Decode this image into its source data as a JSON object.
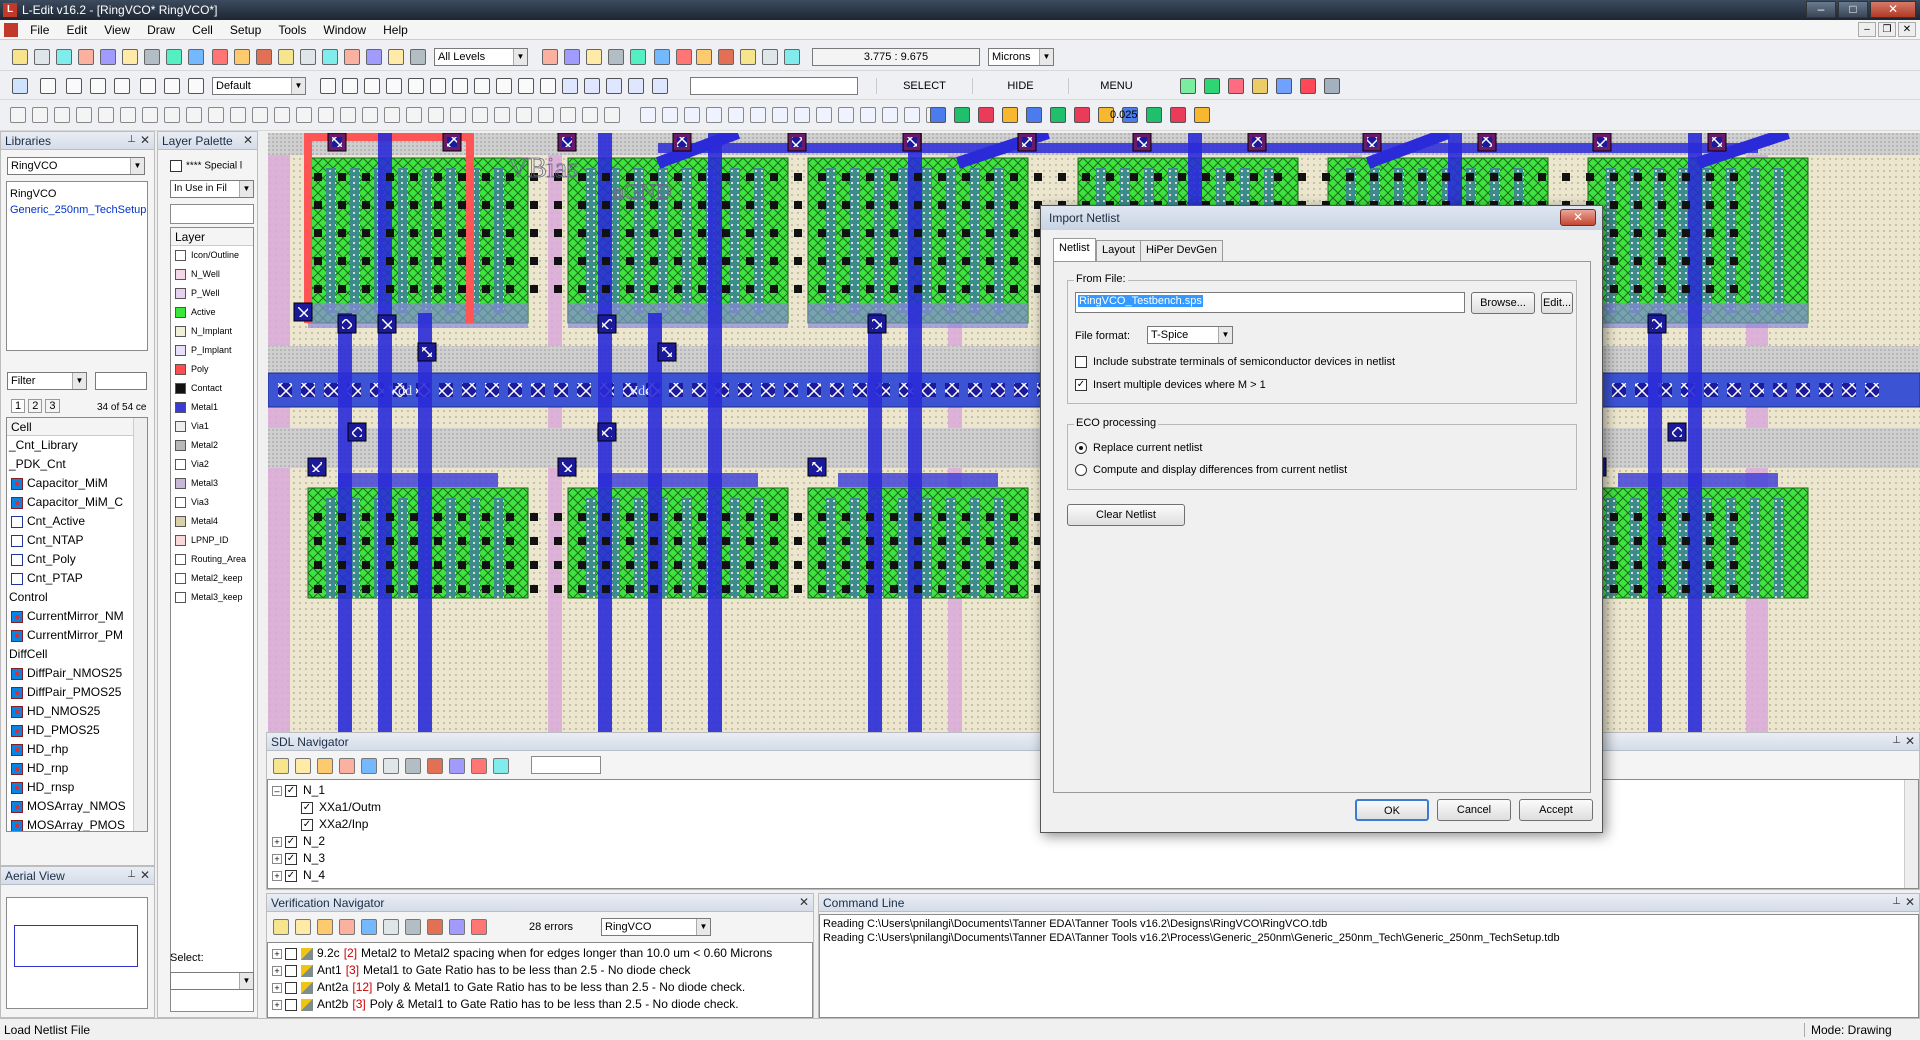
{
  "window": {
    "title": "L-Edit v16.2 - [RingVCO*    RingVCO*]",
    "btn_min": "–",
    "btn_max": "□",
    "btn_close": "✕"
  },
  "menu": [
    "File",
    "Edit",
    "View",
    "Draw",
    "Cell",
    "Setup",
    "Tools",
    "Window",
    "Help"
  ],
  "toolbar": {
    "level_select": "All Levels",
    "coords": "3.775 : 9.675",
    "units_select": "Microns",
    "style_select": "Default",
    "select_btn": "SELECT",
    "hide_btn": "HIDE",
    "menu_btn": "MENU",
    "snap_value": "0.025"
  },
  "libraries": {
    "title": "Libraries",
    "lib_select": "RingVCO",
    "items": [
      "RingVCO",
      "Generic_250nm_TechSetup"
    ],
    "filter_select": "Filter",
    "page_tabs": [
      "1",
      "2",
      "3"
    ],
    "count": "34 of 54 ce",
    "cell_header": "Cell",
    "cells": [
      {
        "name": "_Cnt_Library",
        "type": "group"
      },
      {
        "name": "_PDK_Cnt",
        "type": "group"
      },
      {
        "name": "Capacitor_MiM",
        "type": "gen"
      },
      {
        "name": "Capacitor_MiM_C",
        "type": "gen"
      },
      {
        "name": "Cnt_Active",
        "type": "cell"
      },
      {
        "name": "Cnt_NTAP",
        "type": "cell"
      },
      {
        "name": "Cnt_Poly",
        "type": "cell"
      },
      {
        "name": "Cnt_PTAP",
        "type": "cell"
      },
      {
        "name": "Control",
        "type": "group"
      },
      {
        "name": "CurrentMirror_NM",
        "type": "gen"
      },
      {
        "name": "CurrentMirror_PM",
        "type": "gen"
      },
      {
        "name": "DiffCell",
        "type": "group"
      },
      {
        "name": "DiffPair_NMOS25",
        "type": "gen"
      },
      {
        "name": "DiffPair_PMOS25",
        "type": "gen"
      },
      {
        "name": "HD_NMOS25",
        "type": "gen"
      },
      {
        "name": "HD_PMOS25",
        "type": "gen"
      },
      {
        "name": "HD_rhp",
        "type": "gen"
      },
      {
        "name": "HD_rnp",
        "type": "gen"
      },
      {
        "name": "HD_rnsp",
        "type": "gen"
      },
      {
        "name": "MOSArray_NMOS",
        "type": "gen"
      },
      {
        "name": "MOSArray_PMOS",
        "type": "gen"
      }
    ]
  },
  "aerial": {
    "title": "Aerial View"
  },
  "layer_palette": {
    "title": "Layer Palette",
    "special": "**** Special l",
    "filter_select": "In Use in Fil",
    "layer_header": "Layer",
    "select_label": "Select:",
    "layers": [
      {
        "name": "Icon/Outline",
        "color": "#ffffff"
      },
      {
        "name": "N_Well",
        "color": "#f4d8e8"
      },
      {
        "name": "P_Well",
        "color": "#e8d0f0"
      },
      {
        "name": "Active",
        "color": "#39e639"
      },
      {
        "name": "N_Implant",
        "color": "#f0f0d8"
      },
      {
        "name": "P_Implant",
        "color": "#e8e0f8"
      },
      {
        "name": "Poly",
        "color": "#ff4d4d"
      },
      {
        "name": "Contact",
        "color": "#111111"
      },
      {
        "name": "Metal1",
        "color": "#3a3ad8"
      },
      {
        "name": "Via1",
        "color": "#eeeeee"
      },
      {
        "name": "Metal2",
        "color": "#b8b8b8"
      },
      {
        "name": "Via2",
        "color": "#ffffff"
      },
      {
        "name": "Metal3",
        "color": "#c8b8d8"
      },
      {
        "name": "Via3",
        "color": "#ffffff"
      },
      {
        "name": "Metal4",
        "color": "#d8d0a8"
      },
      {
        "name": "LPNP_ID",
        "color": "#f8d8d8"
      },
      {
        "name": "Routing_Area",
        "color": "#ffffff"
      },
      {
        "name": "Metal2_keep",
        "color": "#ffffff"
      },
      {
        "name": "Metal3_keep",
        "color": "#ffffff"
      }
    ]
  },
  "canvas_labels": {
    "vbias": "VBias",
    "gnd": "GND",
    "ngnd": "nGND",
    "vdd": "Vdd"
  },
  "sdl": {
    "title": "SDL Navigator",
    "rows": [
      {
        "label": "N_1",
        "level": 0,
        "exp": "–"
      },
      {
        "label": "XXa1/Outm",
        "level": 1,
        "exp": ""
      },
      {
        "label": "XXa2/Inp",
        "level": 1,
        "exp": ""
      },
      {
        "label": "N_2",
        "level": 0,
        "exp": "+"
      },
      {
        "label": "N_3",
        "level": 0,
        "exp": "+"
      },
      {
        "label": "N_4",
        "level": 0,
        "exp": "+"
      }
    ]
  },
  "verification": {
    "title": "Verification Navigator",
    "errors_label": "28 errors",
    "cell_select": "RingVCO",
    "rows": [
      {
        "id": "9.2c",
        "count": "[2]",
        "text": "Metal2 to Metal2 spacing when for edges longer than 10.0 um < 0.60 Microns"
      },
      {
        "id": "Ant1",
        "count": "[3]",
        "text": "Metal1 to Gate Ratio has to be less than 2.5 - No diode check"
      },
      {
        "id": "Ant2a",
        "count": "[12]",
        "text": "Poly & Metal1 to Gate Ratio has to be less than 2.5 - No diode check."
      },
      {
        "id": "Ant2b",
        "count": "[3]",
        "text": "Poly & Metal1 to Gate Ratio has to be less than 2.5 - No diode check."
      }
    ]
  },
  "command": {
    "title": "Command Line",
    "lines": [
      "Reading C:\\Users\\pnilangi\\Documents\\Tanner EDA\\Tanner Tools v16.2\\Designs\\RingVCO\\RingVCO.tdb",
      "Reading C:\\Users\\pnilangi\\Documents\\Tanner EDA\\Tanner Tools v16.2\\Process\\Generic_250nm\\Generic_250nm_Tech\\Generic_250nm_TechSetup.tdb"
    ]
  },
  "dialog": {
    "title": "Import Netlist",
    "close": "✕",
    "tabs": [
      "Netlist",
      "Layout",
      "HiPer DevGen"
    ],
    "from_file_label": "From File:",
    "from_file_value": "RingVCO_Testbench.sps",
    "browse": "Browse...",
    "edit": "Edit...",
    "file_format_label": "File format:",
    "file_format_value": "T-Spice",
    "opt_substrate": "Include substrate terminals of semiconductor devices in netlist",
    "opt_multiple": "Insert multiple devices where M > 1",
    "eco_label": "ECO processing",
    "eco_replace": "Replace current netlist",
    "eco_compute": "Compute and display differences from current netlist",
    "clear": "Clear Netlist",
    "ok": "OK",
    "cancel": "Cancel",
    "accept": "Accept"
  },
  "status": {
    "left": "Load Netlist File",
    "mode": "Mode: Drawing"
  }
}
